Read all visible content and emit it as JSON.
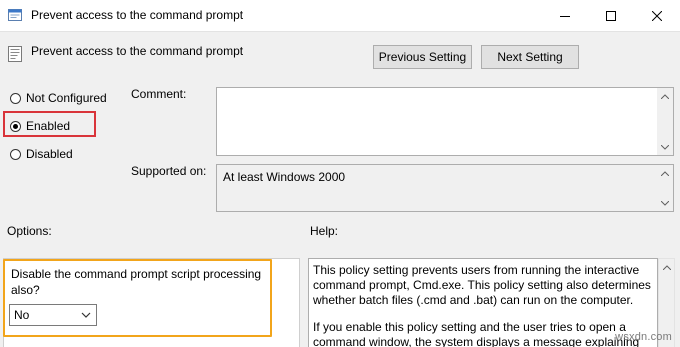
{
  "window": {
    "title": "Prevent access to the command prompt",
    "minimize": "minimize",
    "maximize": "maximize",
    "close": "close"
  },
  "header": {
    "policy_title": "Prevent access to the command prompt",
    "previous_setting": "Previous Setting",
    "next_setting": "Next Setting"
  },
  "state": {
    "options": [
      {
        "label": "Not Configured",
        "checked": false
      },
      {
        "label": "Enabled",
        "checked": true
      },
      {
        "label": "Disabled",
        "checked": false
      }
    ],
    "highlight_color": "#d9343a"
  },
  "comment": {
    "label": "Comment:",
    "value": ""
  },
  "supported": {
    "label": "Supported on:",
    "value": "At least Windows 2000"
  },
  "options_section": {
    "label": "Options:",
    "option_label": "Disable the command prompt script processing also?",
    "select_value": "No",
    "highlight_color": "#f2a51b"
  },
  "help_section": {
    "label": "Help:",
    "paragraphs": [
      "This policy setting prevents users from running the interactive command prompt, Cmd.exe.  This policy setting also determines whether batch files (.cmd and .bat) can run on the computer.",
      "If you enable this policy setting and the user tries to open a command window, the system displays a message explaining"
    ]
  },
  "watermark": "wsxdn.com"
}
